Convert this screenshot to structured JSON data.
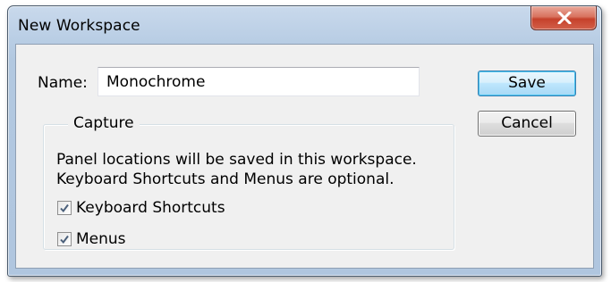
{
  "window": {
    "title": "New Workspace"
  },
  "name_field": {
    "label": "Name:",
    "value": "Monochrome"
  },
  "buttons": {
    "save_label": "Save",
    "cancel_label": "Cancel"
  },
  "capture": {
    "title": "Capture",
    "info_line1": "Panel locations will be saved in this workspace.",
    "info_line2": "Keyboard Shortcuts and Menus are optional.",
    "options": [
      {
        "label": "Keyboard Shortcuts",
        "checked": true
      },
      {
        "label": "Menus",
        "checked": true
      }
    ]
  },
  "colors": {
    "close_button": "#c6412b",
    "default_button_border": "#3c7fb1",
    "dialog_background": "#f0f0f0"
  }
}
